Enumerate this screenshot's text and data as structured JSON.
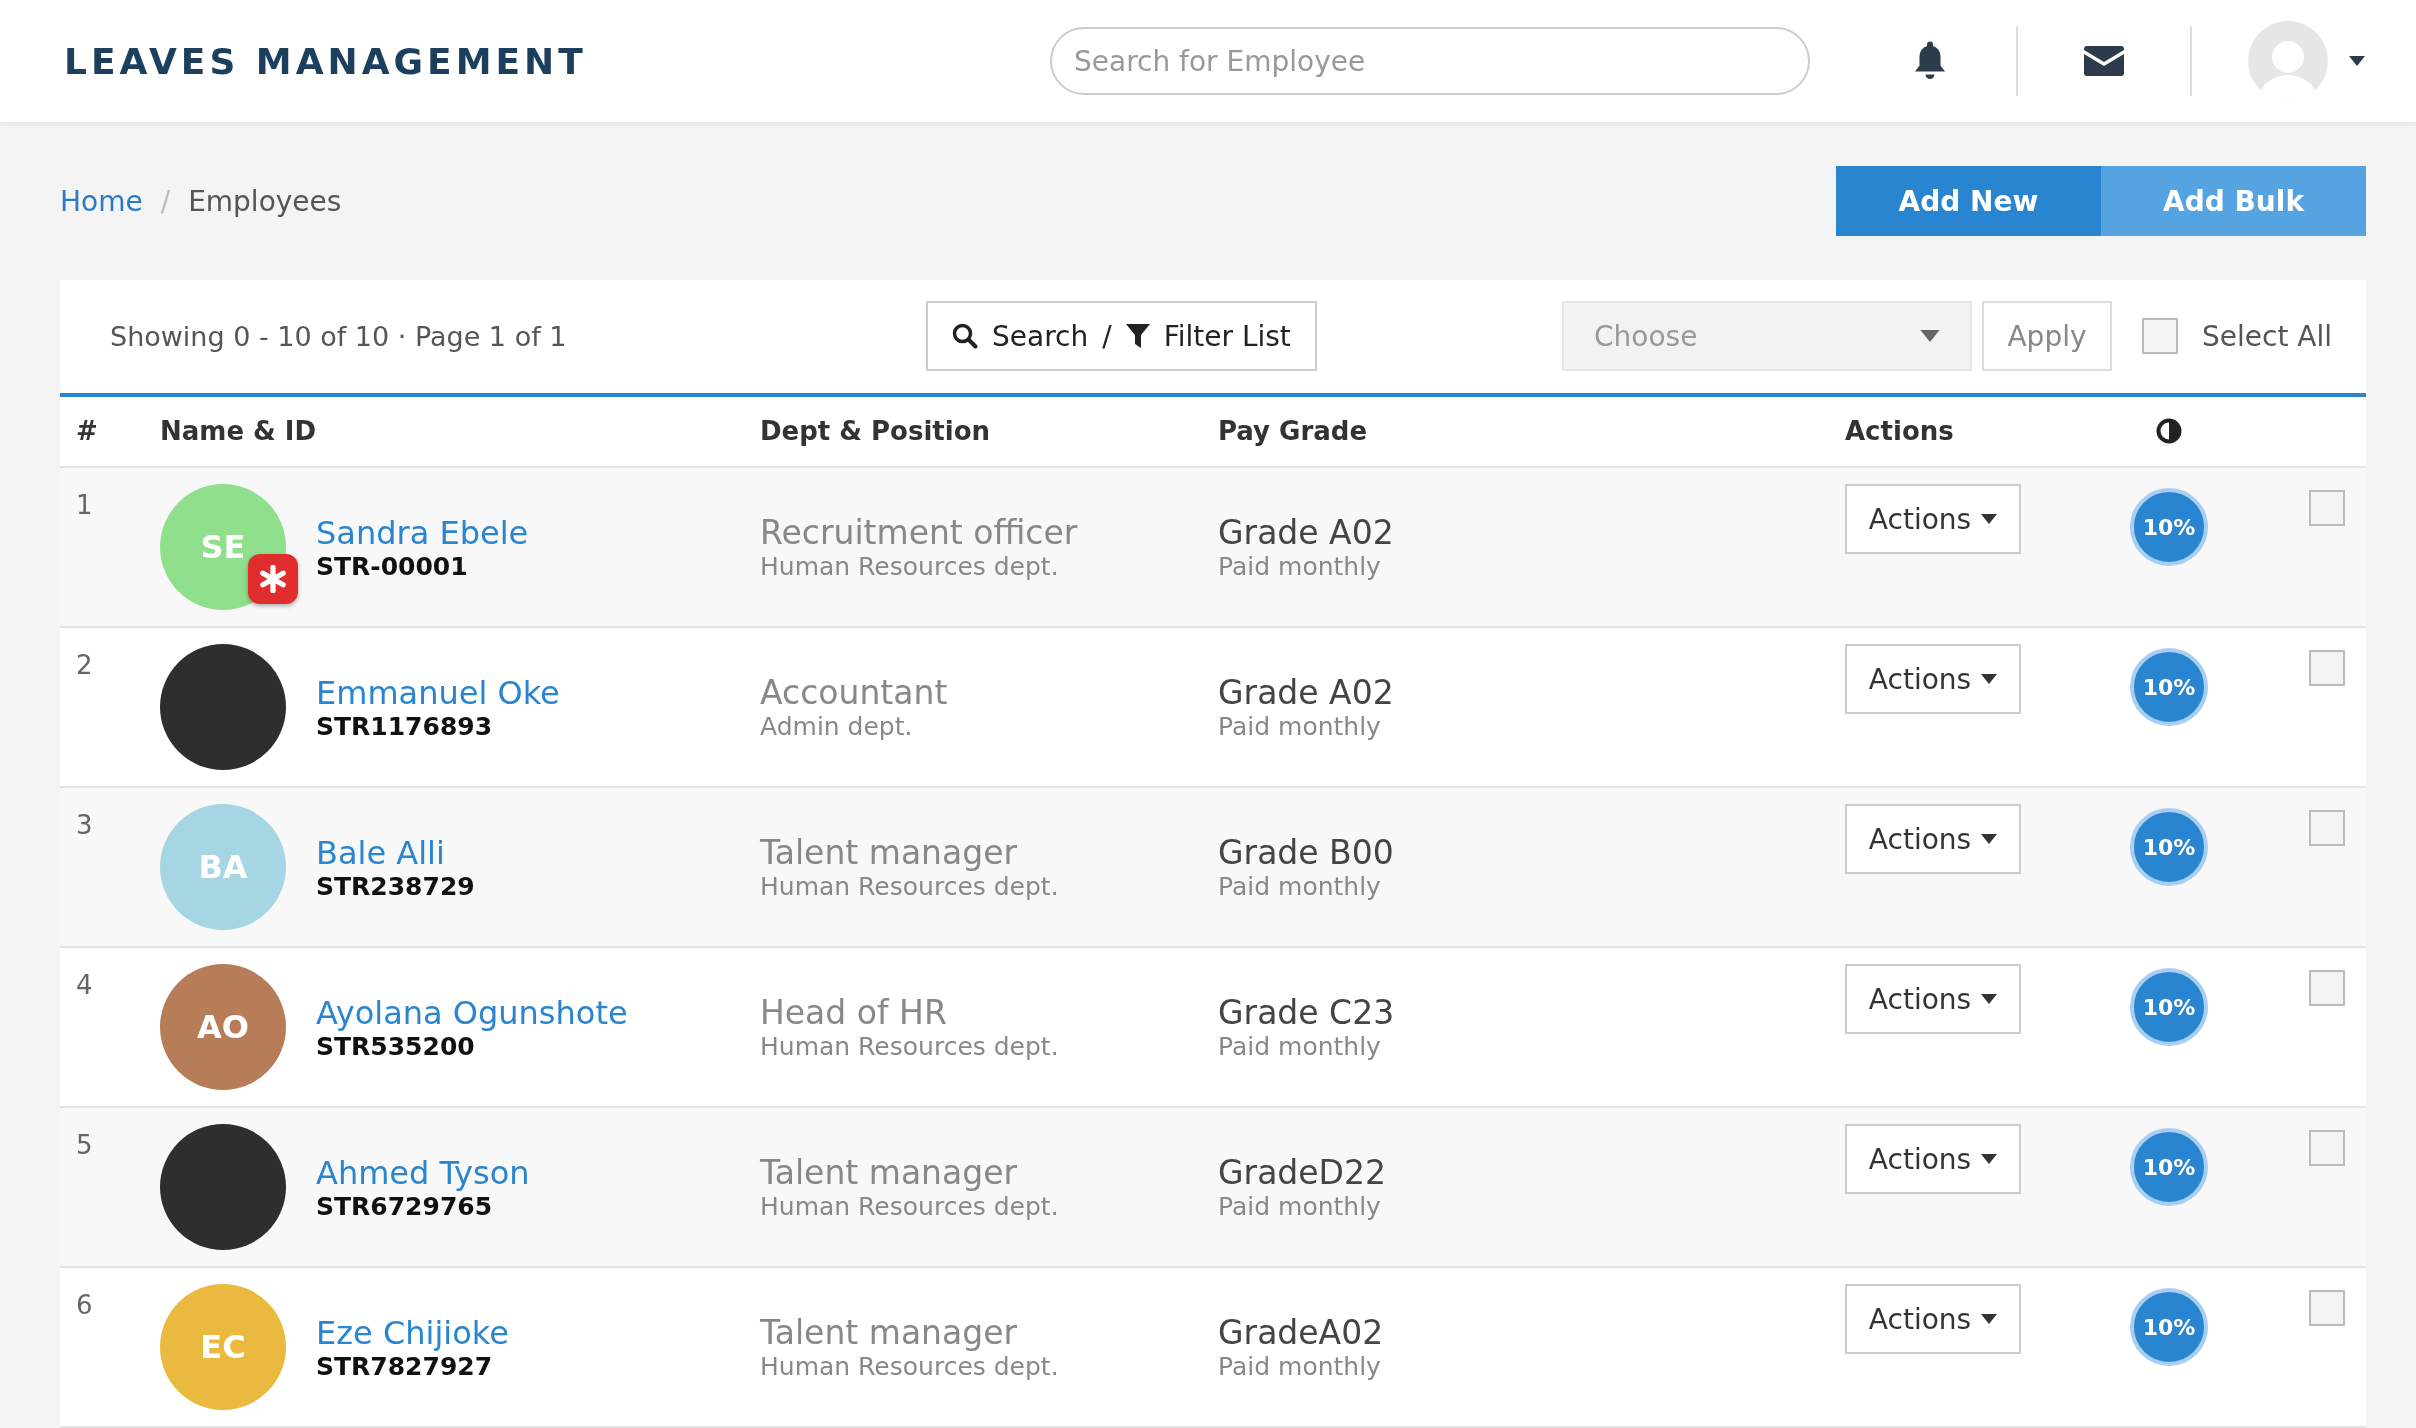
{
  "app_title": "LEAVES MANAGEMENT",
  "search": {
    "placeholder": "Search for Employee"
  },
  "breadcrumb": [
    {
      "label": "Home",
      "kind": "link"
    },
    {
      "label": "Employees",
      "kind": "current",
      "separator": "/"
    }
  ],
  "header_buttons": [
    {
      "label": "Add New",
      "selected": true
    },
    {
      "label": "Add Bulk",
      "selected": false
    }
  ],
  "toolbar": {
    "summary": "Showing 0 - 10 of 10 · Page 1 of 1",
    "search_label": "Search",
    "separator": "/",
    "filter_label": "Filter List",
    "choose": {
      "placeholder": "Choose"
    },
    "apply": "Apply",
    "select_all": {
      "label": "Select All",
      "checked": false
    }
  },
  "table": {
    "columns": [
      "#",
      "Name & ID",
      "Dept & Position",
      "Pay Grade",
      "Actions"
    ],
    "rows": [
      {
        "index": "1",
        "name": "Sandra Ebele",
        "id": "STR-00001",
        "avatar": {
          "kind": "initials",
          "initials": "SE",
          "color": "#8fdf8c"
        },
        "flagged": true,
        "position": "Recruitment officer",
        "dept": "Human Resources dept.",
        "grade": "Grade A02",
        "pay": "Paid monthly",
        "action": "Actions",
        "progress": "10%",
        "checked": false
      },
      {
        "index": "2",
        "name": "Emmanuel Oke",
        "id": "STR1176893",
        "avatar": {
          "kind": "photo"
        },
        "flagged": false,
        "position": "Accountant",
        "dept": "Admin dept.",
        "grade": "Grade A02",
        "pay": "Paid monthly",
        "action": "Actions",
        "progress": "10%",
        "checked": false
      },
      {
        "index": "3",
        "name": "Bale Alli",
        "id": "STR238729",
        "avatar": {
          "kind": "initials",
          "initials": "BA",
          "color": "#a6d5e3"
        },
        "flagged": false,
        "position": "Talent manager",
        "dept": "Human Resources dept.",
        "grade": "Grade B00",
        "pay": "Paid monthly",
        "action": "Actions",
        "progress": "10%",
        "checked": false
      },
      {
        "index": "4",
        "name": "Ayolana Ogunshote",
        "id": "STR535200",
        "avatar": {
          "kind": "initials",
          "initials": "AO",
          "color": "#b77d58"
        },
        "flagged": false,
        "position": "Head of HR",
        "dept": "Human Resources dept.",
        "grade": "Grade C23",
        "pay": "Paid monthly",
        "action": "Actions",
        "progress": "10%",
        "checked": false
      },
      {
        "index": "5",
        "name": "Ahmed Tyson",
        "id": "STR6729765",
        "avatar": {
          "kind": "photo"
        },
        "flagged": false,
        "position": "Talent manager",
        "dept": "Human Resources dept.",
        "grade": "GradeD22",
        "pay": "Paid monthly",
        "action": "Actions",
        "progress": "10%",
        "checked": false
      },
      {
        "index": "6",
        "name": "Eze Chijioke",
        "id": "STR7827927",
        "avatar": {
          "kind": "initials",
          "initials": "EC",
          "color": "#e9b940"
        },
        "flagged": false,
        "position": "Talent manager",
        "dept": "Human Resources dept.",
        "grade": "GradeA02",
        "pay": "Paid monthly",
        "action": "Actions",
        "progress": "10%",
        "checked": false
      }
    ]
  }
}
